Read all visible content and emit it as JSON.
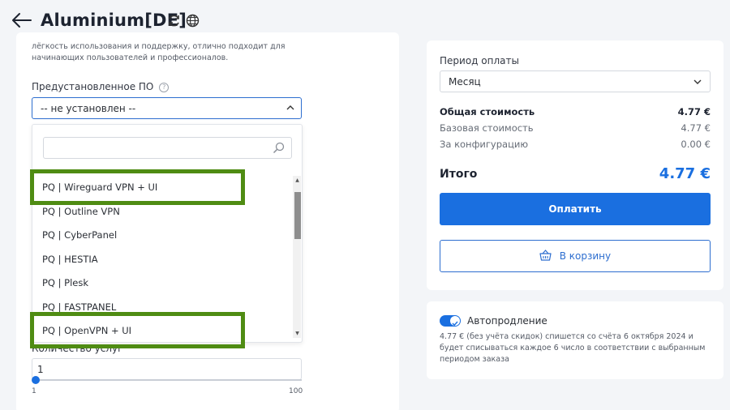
{
  "header": {
    "title": "Aluminium[DE]",
    "back_icon": "arrow-left-icon",
    "refresh_icon": "refresh-icon",
    "globe_icon": "globe-icon"
  },
  "left": {
    "description": "лёгкость использования и поддержку, отлично подходит для начинающих пользователей и профессионалов.",
    "preinstalled_label": "Предустановленное ПО",
    "help_glyph": "?",
    "selected_value": "-- не установлен --",
    "search_placeholder": "",
    "options": [
      "PQ | Wireguard VPN + UI",
      "PQ | Outline VPN",
      "PQ | CyberPanel",
      "PQ | HESTIA",
      "PQ | Plesk",
      "PQ | FASTPANEL",
      "PQ | OpenVPN + UI"
    ],
    "quantity_label": "Количество услуг",
    "quantity_value": "1",
    "slider_min": "1",
    "slider_max": "100",
    "slider_fraction": 0.0
  },
  "summary": {
    "period_label": "Период оплаты",
    "period_value": "Месяц",
    "rows": [
      {
        "label": "Общая стоимость",
        "value": "4.77 €"
      },
      {
        "label": "Базовая стоимость",
        "value": "4.77 €"
      },
      {
        "label": "За конфигурацию",
        "value": "0.00 €"
      }
    ],
    "total_label": "Итого",
    "total_value": "4.77 €",
    "pay_label": "Оплатить",
    "cart_label": "В корзину"
  },
  "renew": {
    "label": "Автопродление",
    "enabled": true,
    "text": "4.77 € (без учёта скидок) спишется со счёта 6 октября 2024 и будет списываться каждое 6 число в соответствии с выбранным периодом заказа"
  },
  "colors": {
    "accent": "#1a6fe0",
    "highlight": "#4f8c13"
  }
}
